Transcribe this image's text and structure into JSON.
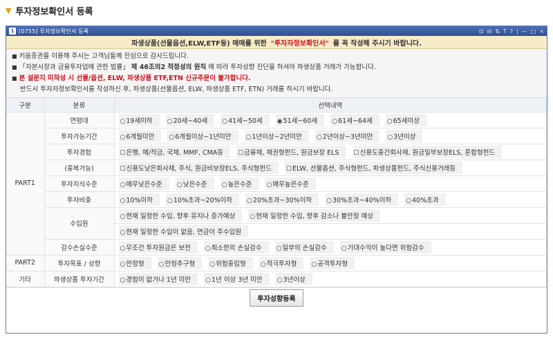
{
  "page": {
    "title": "투자정보확인서 등록"
  },
  "window": {
    "id": "0755",
    "title": "투자정보확인서 등록",
    "controls": [
      "⊡",
      "⊟",
      "⇅",
      "T",
      "?",
      "|",
      "—",
      "□",
      "×"
    ]
  },
  "banner": {
    "lead": "파생상품(선물옵션,ELW,ETF등) 매매를 위한",
    "highlight": "\"투자자정보확인서\"",
    "tail": "를 꼭 작성해 주시기 바랍니다."
  },
  "notices": {
    "n1": "키움증권을 이용해 주시는 고객님들께 진심으로 감사드립니다.",
    "n2a": "「자본시장과 금융투자업에 관한 법률」",
    "n2b": "제 46조의2 적정성의 원칙",
    "n2c": "에 따라 투자성향 진단을 하셔야 파생상품 거래가 가능합니다.",
    "n3a": "본 설문지",
    "n3b": "미작성 시 선물/옵션, ELW, 파생상품 ETF,ETN 신규주문이 불가합니다.",
    "n4": "반드시 투자자정보확인서를 작성하신 후, 파생상품(선물옵션, ELW, 파생상품 ETF, ETN) 거래를 하시기 바랍니다."
  },
  "table": {
    "headers": {
      "part": "구분",
      "category": "분류",
      "choices": "선택내역"
    },
    "parts": {
      "p1": "PART1",
      "p2": "PART2",
      "etc": "기타"
    },
    "rows": {
      "age": {
        "label": "연령대",
        "options": [
          "19세이하",
          "20세~40세",
          "41세~50세",
          "51세~60세",
          "61세~64세",
          "65세이상"
        ],
        "selected": 3
      },
      "period": {
        "label": "투자가능기간",
        "options": [
          "6개월미만",
          "6개월이상~1년미만",
          "1년이상~2년미만",
          "2년이상~3년미만",
          "3년이상"
        ]
      },
      "experience": {
        "label1": "투자경험",
        "label2": "(중복가능)",
        "line1": [
          "은행, 예/적금, 국채, MMF, CMA등",
          "금융채, 채권형펀드, 원금보장 ELS",
          "신용도중간회사채, 원금일부보장ELS, 혼합형펀드"
        ],
        "line2": [
          "신용도낮은회사채, 주식, 원금비보장ELS, 주식형펀드",
          "ELW, 선물옵션, 주식형펀드, 파생상품펀드, 주식신용거래등"
        ]
      },
      "knowledge": {
        "label": "투자지식수준",
        "options": [
          "매우낮은수준",
          "낮은수준",
          "높은수준",
          "매우높은수준"
        ]
      },
      "ratio": {
        "label": "투자비중",
        "options": [
          "10%이하",
          "10%초과~20%이하",
          "20%초과~30%이하",
          "30%초과~40%이하",
          "40%초과"
        ]
      },
      "income": {
        "label": "수입원",
        "options": [
          "현재 일정한 수입, 향후 유지나 증가예상",
          "현재 일정한 수입, 향후 감소나 불안정 예상",
          "현재 일정한 수입이 없음, 연금이 주수입원"
        ]
      },
      "loss": {
        "label": "감수손실수준",
        "options": [
          "무조건 투자원금은 보전",
          "최소한의 손실감수",
          "일부의 손실감수",
          "기대수익이 높다면 위험감수"
        ]
      },
      "goal": {
        "label": "투자목표 / 성향",
        "options": [
          "안정형",
          "안정추구형",
          "위험중립형",
          "적극투자형",
          "공격투자형"
        ]
      },
      "deriv": {
        "label": "파생상품 투자기간",
        "options": [
          "경험이 없거나 1년 미만",
          "1년 이상 3년 미만",
          "3년이상"
        ]
      }
    }
  },
  "footer": {
    "register_label": "투자성향등록"
  }
}
